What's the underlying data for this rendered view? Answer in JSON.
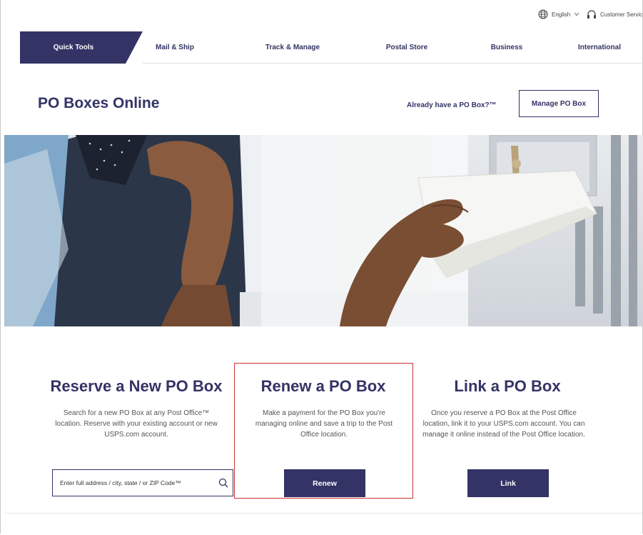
{
  "utility": {
    "language": "English",
    "language_icon": "globe-icon",
    "customer_service": "Customer Servic",
    "customer_service_icon": "headset-icon"
  },
  "nav": {
    "tabs": [
      {
        "label": "Quick Tools",
        "active": true
      },
      {
        "label": "Mail & Ship",
        "active": false
      },
      {
        "label": "Track & Manage",
        "active": false
      },
      {
        "label": "Postal Store",
        "active": false
      },
      {
        "label": "Business",
        "active": false
      },
      {
        "label": "International",
        "active": false
      }
    ]
  },
  "header": {
    "title": "PO Boxes Online",
    "already_text": "Already have a PO Box?™",
    "manage_button": "Manage PO Box"
  },
  "cards": {
    "reserve": {
      "title": "Reserve a New PO Box",
      "description": "Search for a new PO Box at any Post Office™ location. Reserve with your existing account or new USPS.com account.",
      "search_placeholder": "Enter full address / city, state / or ZIP Code™"
    },
    "renew": {
      "title": "Renew a PO Box",
      "description": "Make a payment for the PO Box you're managing online and save a trip to the Post Office location.",
      "button": "Renew"
    },
    "link": {
      "title": "Link a PO Box",
      "description": "Once you reserve a PO Box at the Post Office location, link it to your USPS.com account. You can manage it online instead of the Post Office location.",
      "button": "Link"
    }
  },
  "colors": {
    "brand_navy": "#333366",
    "highlight_red": "#cc3333"
  }
}
